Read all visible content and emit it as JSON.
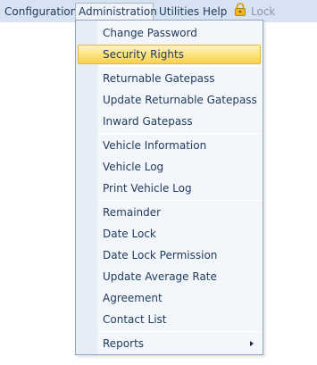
{
  "menubar": {
    "items": [
      {
        "label": "Configuration"
      },
      {
        "label": "Administration"
      },
      {
        "label": "Utilities"
      },
      {
        "label": "Help"
      },
      {
        "label": "Lock",
        "icon": "padlock-icon"
      }
    ]
  },
  "dropdown": {
    "items": [
      {
        "label": "Change Password"
      },
      {
        "label": "Security Rights",
        "highlighted": true
      },
      {
        "label": "Returnable Gatepass"
      },
      {
        "label": "Update Returnable Gatepass"
      },
      {
        "label": "Inward Gatepass"
      },
      {
        "label": "Vehicle Information"
      },
      {
        "label": "Vehicle Log"
      },
      {
        "label": "Print Vehicle Log"
      },
      {
        "label": "Remainder"
      },
      {
        "label": "Date Lock"
      },
      {
        "label": "Date Lock Permission"
      },
      {
        "label": "Update Average Rate"
      },
      {
        "label": "Agreement"
      },
      {
        "label": "Contact List"
      },
      {
        "label": "Reports",
        "has_submenu": true
      }
    ]
  },
  "colors": {
    "menubar_bg": "#d7e3f2",
    "text": "#1e395b",
    "highlight": "#fde27b",
    "disabled_text": "#8a96a6"
  }
}
